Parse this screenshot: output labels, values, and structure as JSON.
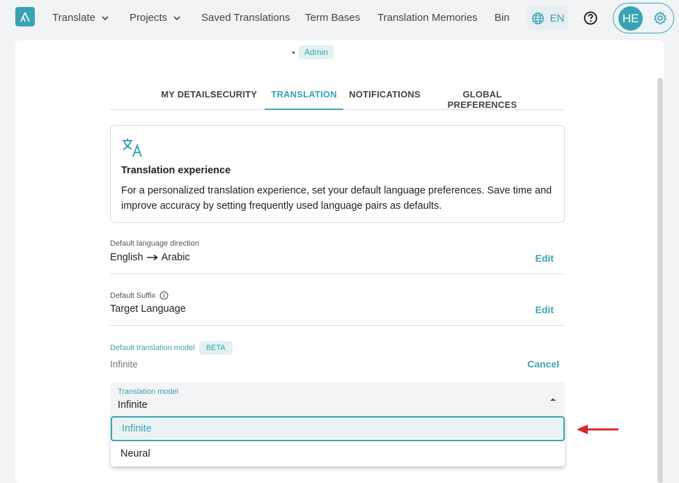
{
  "nav": {
    "items": [
      {
        "label": "Translate",
        "has_dropdown": true
      },
      {
        "label": "Projects",
        "has_dropdown": true
      },
      {
        "label": "Saved Translations",
        "has_dropdown": false
      },
      {
        "label": "Term Bases",
        "has_dropdown": false
      },
      {
        "label": "Translation Memories",
        "has_dropdown": false
      },
      {
        "label": "Bin",
        "has_dropdown": false
      }
    ],
    "language": "EN",
    "user_initials": "HE"
  },
  "profile": {
    "role": "Admin"
  },
  "tabs": [
    {
      "label": "MY DETAILS",
      "active": false
    },
    {
      "label": "SECURITY",
      "active": false
    },
    {
      "label": "TRANSLATION",
      "active": true
    },
    {
      "label": "NOTIFICATIONS",
      "active": false
    },
    {
      "label": "GLOBAL PREFERENCES",
      "active": false
    }
  ],
  "info": {
    "title": "Translation experience",
    "description": "For a personalized translation experience, set your default language preferences. Save time and improve accuracy by setting frequently used language pairs as defaults."
  },
  "settings": {
    "direction": {
      "label": "Default language direction",
      "source": "English",
      "target": "Arabic",
      "action": "Edit"
    },
    "suffix": {
      "label": "Default Suffix",
      "value": "Target Language",
      "action": "Edit"
    },
    "model": {
      "label": "Default translation model",
      "badge": "BETA",
      "value": "Infinite",
      "action": "Cancel"
    }
  },
  "select": {
    "label": "Translation model",
    "value": "Infinite",
    "options": [
      "Infinite",
      "Neural"
    ]
  },
  "colors": {
    "accent": "#3aa3b3",
    "annotation_arrow": "#d9262c"
  }
}
